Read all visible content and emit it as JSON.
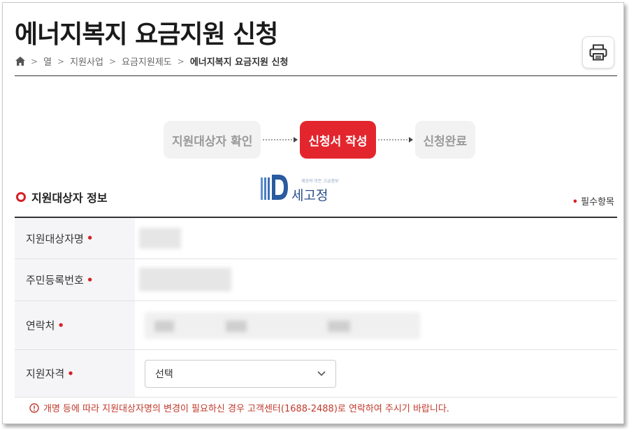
{
  "page": {
    "title": "에너지복지 요금지원 신청"
  },
  "breadcrumb": {
    "items": [
      "열",
      "지원사업",
      "요금지원제도",
      "에너지복지 요금지원 신청"
    ],
    "separator": ">"
  },
  "steps": [
    {
      "label": "지원대상자 확인",
      "state": "inactive"
    },
    {
      "label": "신청서 작성",
      "state": "active"
    },
    {
      "label": "신청완료",
      "state": "inactive"
    }
  ],
  "watermark": {
    "tagline": "세상의 모든 고급정보",
    "name": "세고정"
  },
  "section": {
    "title": "지원대상자 정보",
    "required_mark": "•",
    "required_note": "필수항목"
  },
  "form": {
    "rows": [
      {
        "label": "지원대상자명"
      },
      {
        "label": "주민등록번호"
      },
      {
        "label": "연락처"
      },
      {
        "label": "지원자격"
      }
    ],
    "qualification_select": {
      "value": "선택"
    }
  },
  "notice": {
    "text": "개명 등에 따라 지원대상자명의 변경이 필요하신 경우 고객센터(1688-2488)로 연락하여 주시기 바랍니다."
  },
  "colors": {
    "accent": "#e3262e",
    "required": "#d81f26",
    "notice": "#c0392b"
  },
  "icons": [
    "home-icon",
    "printer-icon",
    "arrow-right-icon",
    "ring-icon",
    "chevron-down-icon",
    "alert-circle-icon"
  ]
}
